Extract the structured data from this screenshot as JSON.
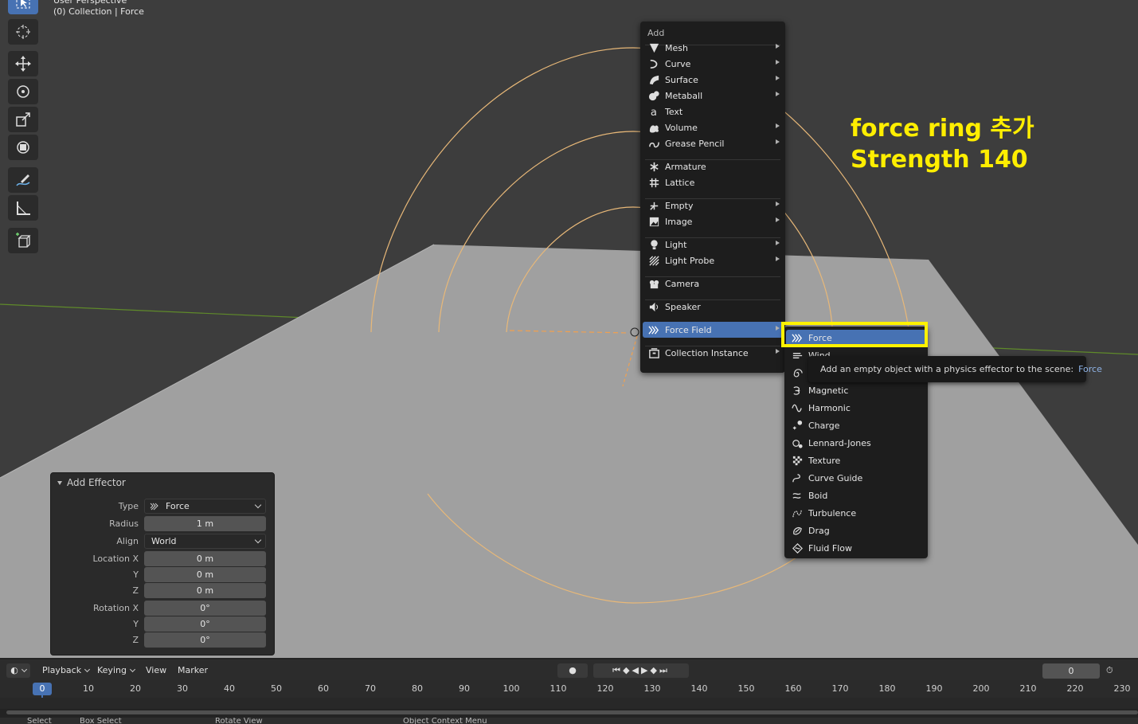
{
  "viewport": {
    "title": "User Perspective",
    "collection": "(0) Collection | Force"
  },
  "toolbar": {
    "tools": [
      "select-box",
      "cursor",
      "move",
      "rotate",
      "scale",
      "transform",
      "annotate",
      "measure",
      "add-cube"
    ]
  },
  "add_menu": {
    "title": "Add",
    "items": [
      {
        "label": "Mesh",
        "icon": "mesh-icon",
        "submenu": true
      },
      {
        "label": "Curve",
        "icon": "curve-icon",
        "submenu": true
      },
      {
        "label": "Surface",
        "icon": "surface-icon",
        "submenu": true
      },
      {
        "label": "Metaball",
        "icon": "metaball-icon",
        "submenu": true
      },
      {
        "label": "Text",
        "icon": "text-icon",
        "submenu": false
      },
      {
        "label": "Volume",
        "icon": "volume-icon",
        "submenu": true
      },
      {
        "label": "Grease Pencil",
        "icon": "grease-pencil-icon",
        "submenu": true
      },
      {
        "label": "Armature",
        "icon": "armature-icon",
        "submenu": false
      },
      {
        "label": "Lattice",
        "icon": "lattice-icon",
        "submenu": false
      },
      {
        "label": "Empty",
        "icon": "empty-icon",
        "submenu": true
      },
      {
        "label": "Image",
        "icon": "image-icon",
        "submenu": true
      },
      {
        "label": "Light",
        "icon": "light-icon",
        "submenu": true
      },
      {
        "label": "Light Probe",
        "icon": "light-probe-icon",
        "submenu": true
      },
      {
        "label": "Camera",
        "icon": "camera-icon",
        "submenu": false
      },
      {
        "label": "Speaker",
        "icon": "speaker-icon",
        "submenu": false
      },
      {
        "label": "Force Field",
        "icon": "force-field-icon",
        "submenu": true,
        "highlighted": true
      },
      {
        "label": "Collection Instance",
        "icon": "collection-instance-icon",
        "submenu": true
      }
    ]
  },
  "force_field_menu": {
    "items": [
      {
        "label": "Force",
        "highlighted": true
      },
      {
        "label": "Wind"
      },
      {
        "label": "Vortex"
      },
      {
        "label": "Magnetic"
      },
      {
        "label": "Harmonic"
      },
      {
        "label": "Charge"
      },
      {
        "label": "Lennard-Jones"
      },
      {
        "label": "Texture"
      },
      {
        "label": "Curve Guide"
      },
      {
        "label": "Boid"
      },
      {
        "label": "Turbulence"
      },
      {
        "label": "Drag"
      },
      {
        "label": "Fluid Flow"
      }
    ]
  },
  "tooltip": {
    "text": "Add an empty object with a physics effector to the scene:",
    "python": "Force"
  },
  "annotation": {
    "line1": "force ring 추가",
    "line2": "Strength 140",
    "color": "#ffee00"
  },
  "redo_panel": {
    "title": "Add Effector",
    "type_label": "Type",
    "type_value": "Force",
    "radius_label": "Radius",
    "radius_value": "1 m",
    "align_label": "Align",
    "align_value": "World",
    "location_x_label": "Location X",
    "location_x": "0 m",
    "location_y_label": "Y",
    "location_y": "0 m",
    "location_z_label": "Z",
    "location_z": "0 m",
    "rotation_x_label": "Rotation X",
    "rotation_x": "0°",
    "rotation_y_label": "Y",
    "rotation_y": "0°",
    "rotation_z_label": "Z",
    "rotation_z": "0°"
  },
  "timeline": {
    "playback": "Playback",
    "keying": "Keying",
    "view": "View",
    "marker": "Marker",
    "current_frame": "0",
    "frame_display": "0",
    "ticks": [
      "10",
      "20",
      "30",
      "40",
      "50",
      "60",
      "70",
      "80",
      "90",
      "100",
      "110",
      "120",
      "130",
      "140",
      "150",
      "160",
      "170",
      "180",
      "190",
      "200",
      "210",
      "220",
      "230"
    ]
  },
  "statusbar": {
    "select": "Select",
    "box_select": "Box Select",
    "rotate_view": "Rotate View",
    "context_menu": "Object Context Menu"
  },
  "colors": {
    "accent": "#4772b3",
    "highlight_box": "#fff200",
    "field_rings": "#e8b878"
  }
}
